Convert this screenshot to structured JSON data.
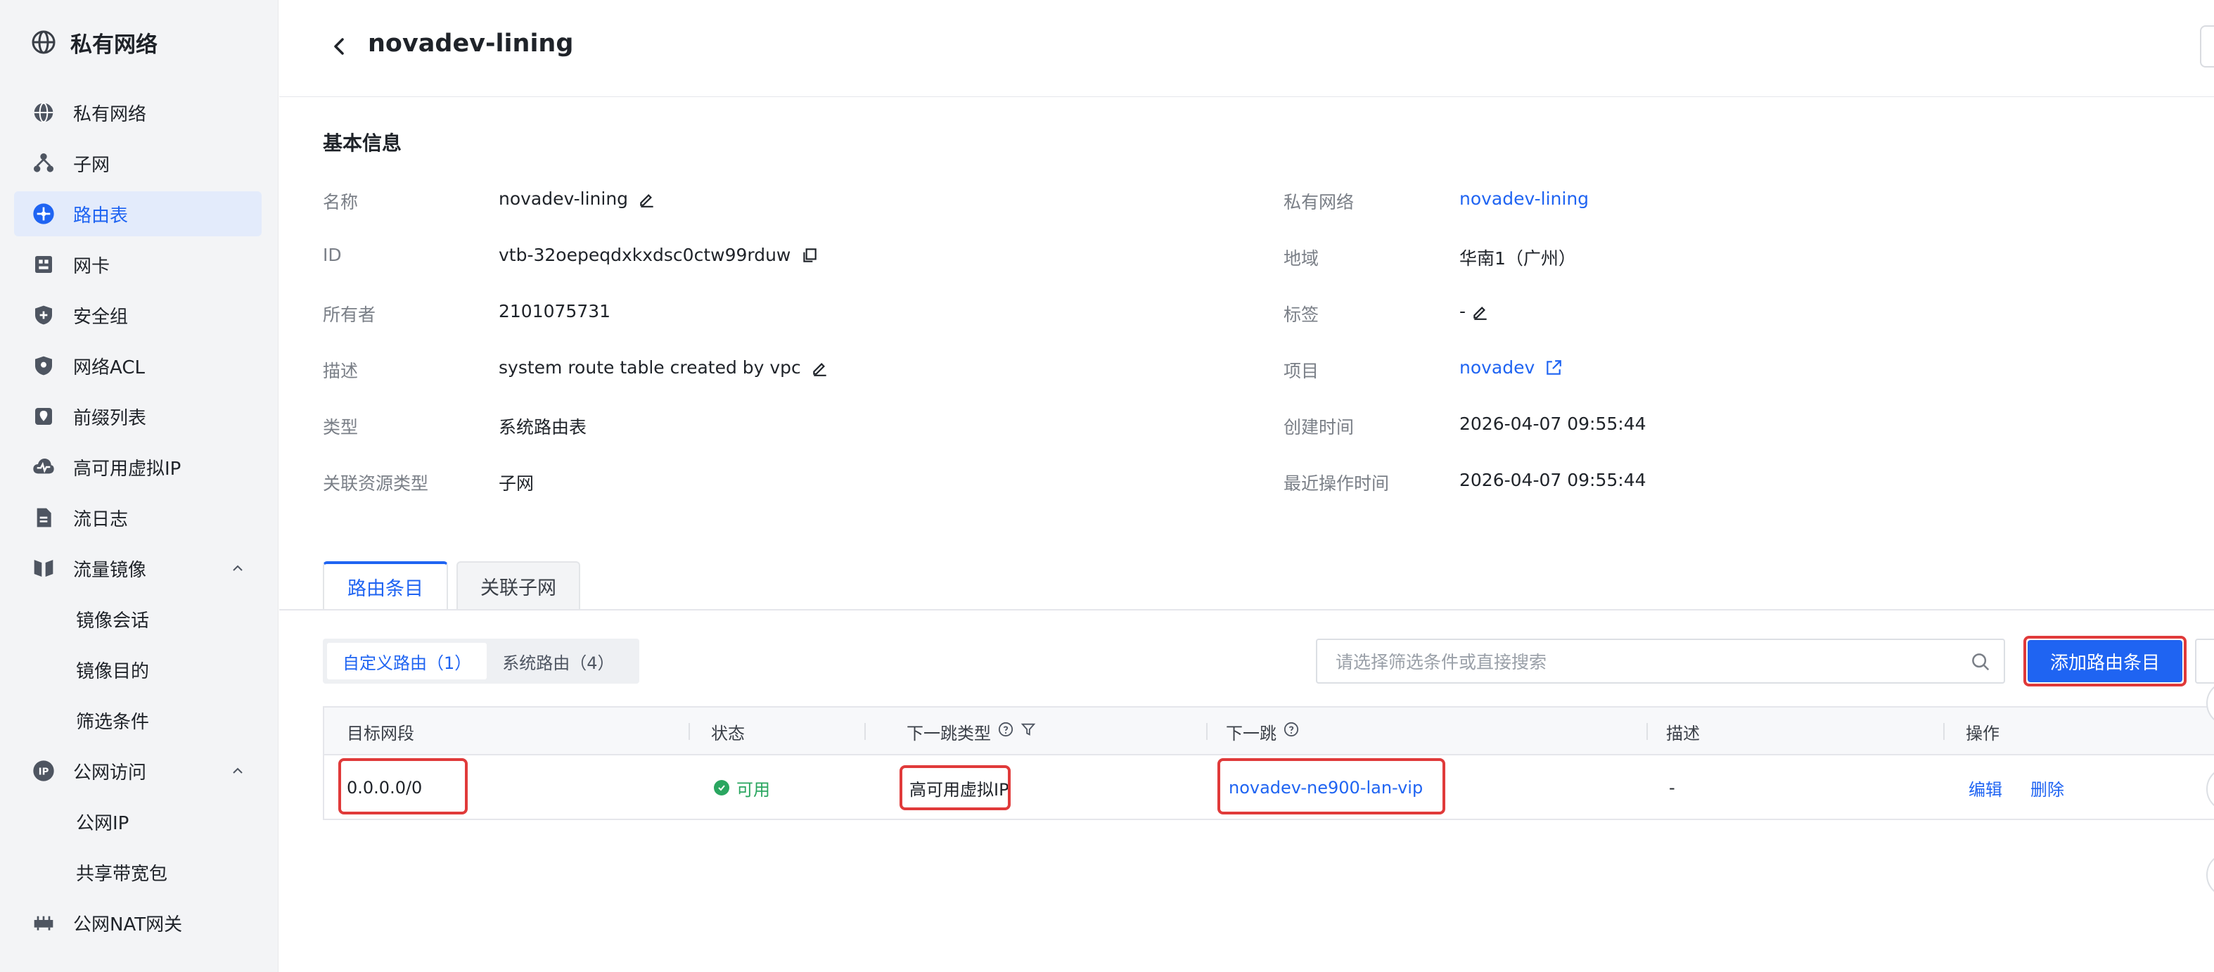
{
  "sidebar": {
    "title": "私有网络",
    "items": [
      {
        "label": "私有网络"
      },
      {
        "label": "子网"
      },
      {
        "label": "路由表"
      },
      {
        "label": "网卡"
      },
      {
        "label": "安全组"
      },
      {
        "label": "网络ACL"
      },
      {
        "label": "前缀列表"
      },
      {
        "label": "高可用虚拟IP"
      },
      {
        "label": "流日志"
      },
      {
        "label": "流量镜像"
      },
      {
        "label": "镜像会话"
      },
      {
        "label": "镜像目的"
      },
      {
        "label": "筛选条件"
      },
      {
        "label": "公网访问"
      },
      {
        "label": "公网IP"
      },
      {
        "label": "共享带宽包"
      },
      {
        "label": "公网NAT网关"
      }
    ],
    "active_item": "路由表"
  },
  "header": {
    "title": "novadev-lining"
  },
  "basic_info": {
    "section_title": "基本信息",
    "left": [
      {
        "label": "名称",
        "value": "novadev-lining"
      },
      {
        "label": "ID",
        "value": "vtb-32oepeqdxkxdsc0ctw99rduw"
      },
      {
        "label": "所有者",
        "value": "2101075731"
      },
      {
        "label": "描述",
        "value": "system route table created by vpc"
      },
      {
        "label": "类型",
        "value": "系统路由表"
      },
      {
        "label": "关联资源类型",
        "value": "子网"
      }
    ],
    "right": [
      {
        "label": "私有网络",
        "value": "novadev-lining"
      },
      {
        "label": "地域",
        "value": "华南1（广州）"
      },
      {
        "label": "标签",
        "value": "-"
      },
      {
        "label": "项目",
        "value": "novadev"
      },
      {
        "label": "创建时间",
        "value": "2026-04-07 09:55:44"
      },
      {
        "label": "最近操作时间",
        "value": "2026-04-07 09:55:44"
      }
    ]
  },
  "tabs": [
    {
      "label": "路由条目",
      "active": true
    },
    {
      "label": "关联子网",
      "active": false
    }
  ],
  "filter": {
    "segments": [
      {
        "label": "自定义路由（1）",
        "active": true
      },
      {
        "label": "系统路由（4）",
        "active": false
      }
    ],
    "search_placeholder": "请选择筛选条件或直接搜索",
    "add_button": "添加路由条目"
  },
  "table": {
    "columns": [
      "目标网段",
      "状态",
      "下一跳类型",
      "下一跳",
      "描述",
      "操作"
    ],
    "rows": [
      {
        "destination": "0.0.0.0/0",
        "status": "可用",
        "next_hop_type": "高可用虚拟IP",
        "next_hop": "novadev-ne900-lan-vip",
        "description": "-",
        "actions": [
          "编辑",
          "删除"
        ]
      }
    ]
  },
  "colors": {
    "accent": "#1f64f2",
    "status_ok": "#2aa660",
    "highlight_box": "#e03a3a"
  }
}
